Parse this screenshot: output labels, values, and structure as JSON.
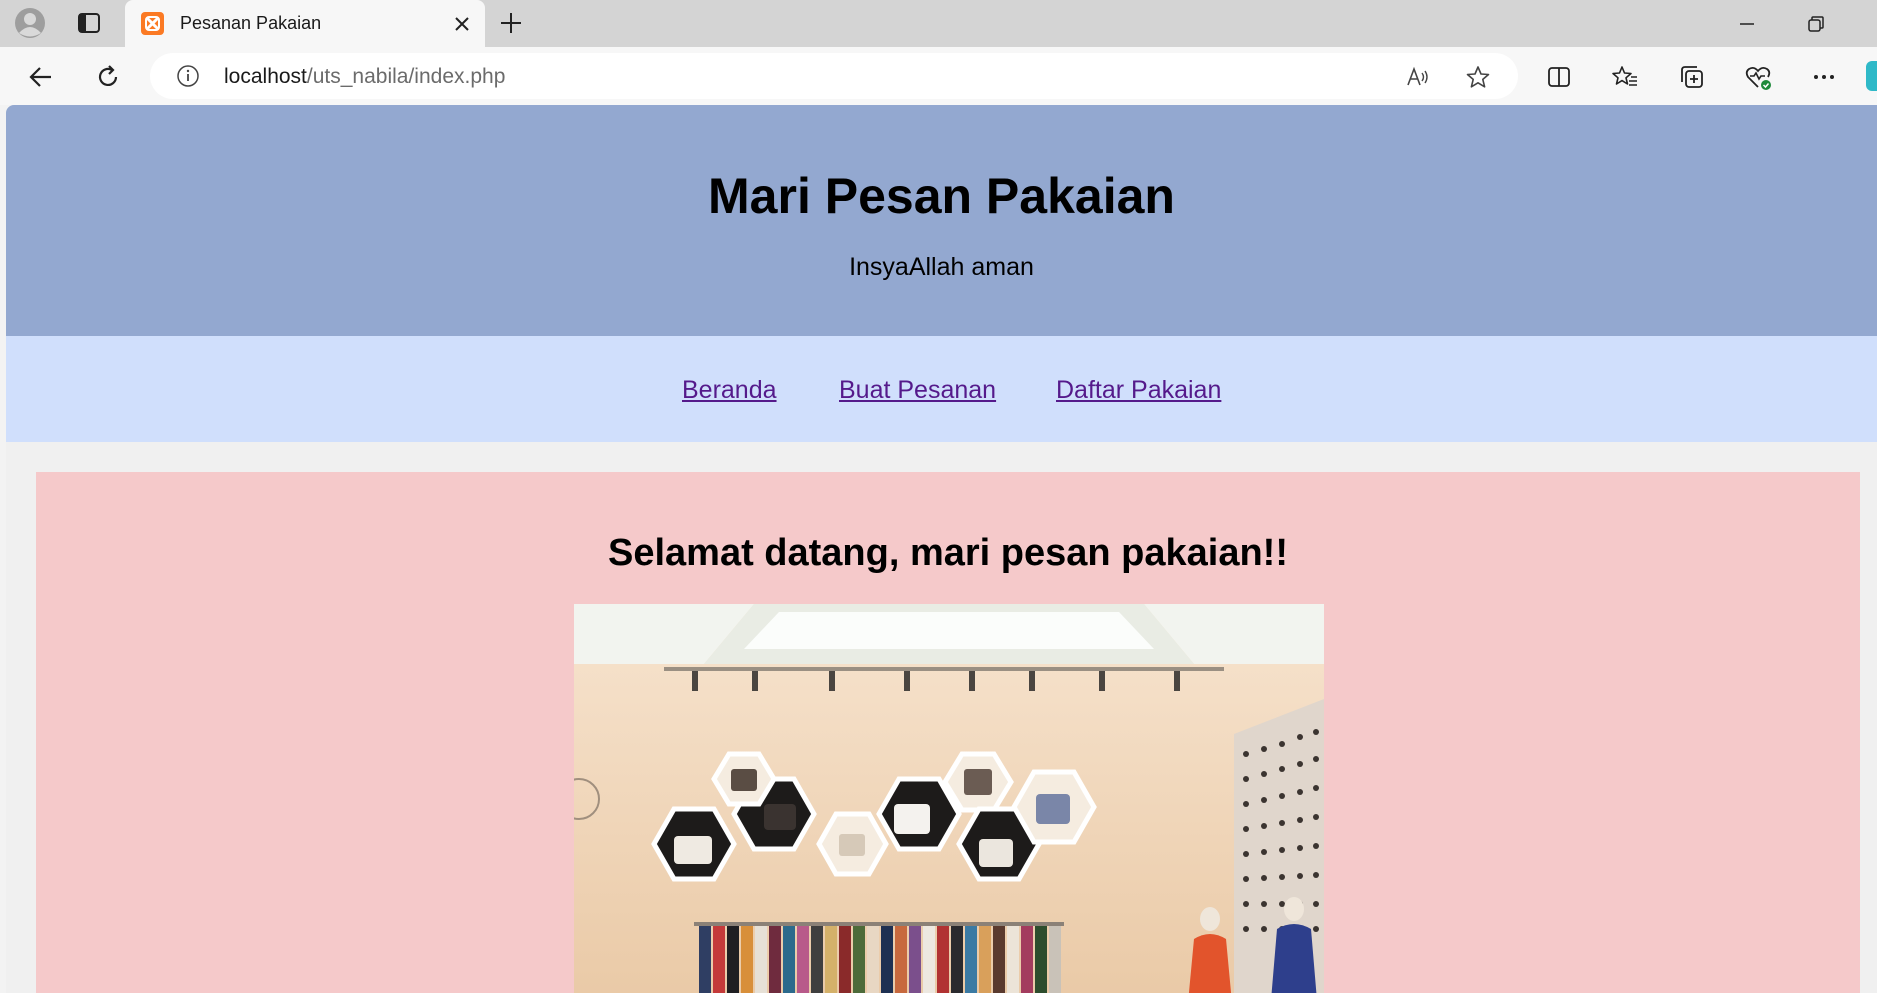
{
  "browser": {
    "tab_title": "Pesanan Pakaian",
    "url_host": "localhost",
    "url_path": "/uts_nabila/index.php"
  },
  "page": {
    "header_title": "Mari Pesan Pakaian",
    "header_subtitle": "InsyaAllah aman",
    "nav": [
      {
        "label": "Beranda"
      },
      {
        "label": "Buat Pesanan"
      },
      {
        "label": "Daftar Pakaian"
      }
    ],
    "welcome_heading": "Selamat datang, mari pesan pakaian!!"
  },
  "colors": {
    "header_bg": "#93a8d0",
    "nav_bg": "#d0dffc",
    "content_bg": "#f5c9ca",
    "link": "#551a8b"
  },
  "icons": [
    "profile-icon",
    "tab-actions-icon",
    "xampp-favicon",
    "close-icon",
    "plus-icon",
    "minimize-icon",
    "restore-icon",
    "back-icon",
    "refresh-icon",
    "info-icon",
    "read-aloud-icon",
    "favorite-icon",
    "split-screen-icon",
    "favorites-icon",
    "collections-icon",
    "browser-essentials-icon",
    "more-icon"
  ]
}
